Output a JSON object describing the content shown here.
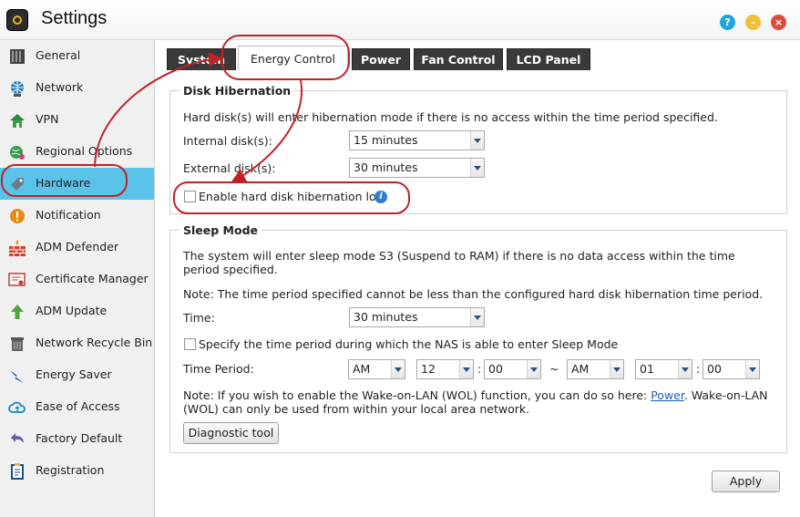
{
  "app": {
    "title": "Settings"
  },
  "window_buttons": {
    "help": "?",
    "minimize": "–",
    "close": "×"
  },
  "sidebar": {
    "items": [
      {
        "label": "General",
        "icon": "server-icon"
      },
      {
        "label": "Network",
        "icon": "globe-icon"
      },
      {
        "label": "VPN",
        "icon": "vpn-house-icon"
      },
      {
        "label": "Regional Options",
        "icon": "regional-globe-icon"
      },
      {
        "label": "Hardware",
        "icon": "hardware-tag-icon"
      },
      {
        "label": "Notification",
        "icon": "exclamation-icon"
      },
      {
        "label": "ADM Defender",
        "icon": "firewall-bricks-icon"
      },
      {
        "label": "Certificate Manager",
        "icon": "certificate-icon"
      },
      {
        "label": "ADM Update",
        "icon": "up-arrow-icon"
      },
      {
        "label": "Network Recycle Bin",
        "icon": "trash-bin-icon"
      },
      {
        "label": "Energy Saver",
        "icon": "lightning-icon"
      },
      {
        "label": "Ease of Access",
        "icon": "cloud-icon"
      },
      {
        "label": "Factory Default",
        "icon": "undo-arrow-icon"
      },
      {
        "label": "Registration",
        "icon": "clipboard-icon"
      }
    ],
    "active": "Hardware"
  },
  "tabs": [
    {
      "label": "System"
    },
    {
      "label": "Energy Control"
    },
    {
      "label": "Power"
    },
    {
      "label": "Fan Control"
    },
    {
      "label": "LCD Panel"
    }
  ],
  "disk_hibernation": {
    "legend": "Disk Hibernation",
    "description": "Hard disk(s) will enter hibernation mode if there is no access within the time period specified.",
    "internal_label": "Internal disk(s):",
    "internal_value": "15 minutes",
    "external_label": "External disk(s):",
    "external_value": "30 minutes",
    "log_label": "Enable hard disk hibernation log",
    "info_icon": "i"
  },
  "sleep_mode": {
    "legend": "Sleep Mode",
    "description": "The system will enter sleep mode S3 (Suspend to RAM) if there is no data access within the time period specified.",
    "note": "Note: The time period specified cannot be less than the configured hard disk hibernation time period.",
    "time_label": "Time:",
    "time_value": "30 minutes",
    "specify_label": "Specify the time period during which the NAS is able to enter Sleep Mode",
    "period_label": "Time Period:",
    "start_ampm": "AM",
    "start_hour": "12",
    "start_min": "00",
    "colon": ":",
    "tilde": "~",
    "end_ampm": "AM",
    "end_hour": "01",
    "end_min": "00",
    "wol_note_prefix": "Note: If you wish to enable the Wake-on-LAN (WOL) function, you can do so here:",
    "wol_link": "Power",
    "wol_note_suffix": ". Wake-on-LAN (WOL) can only be used from within your local area network.",
    "diagnostic_button": "Diagnostic tool"
  },
  "footer": {
    "apply_button": "Apply"
  },
  "colors": {
    "active_sidebar": "#5bc2ea",
    "annotation": "#c02327",
    "link": "#1d5fbf"
  }
}
